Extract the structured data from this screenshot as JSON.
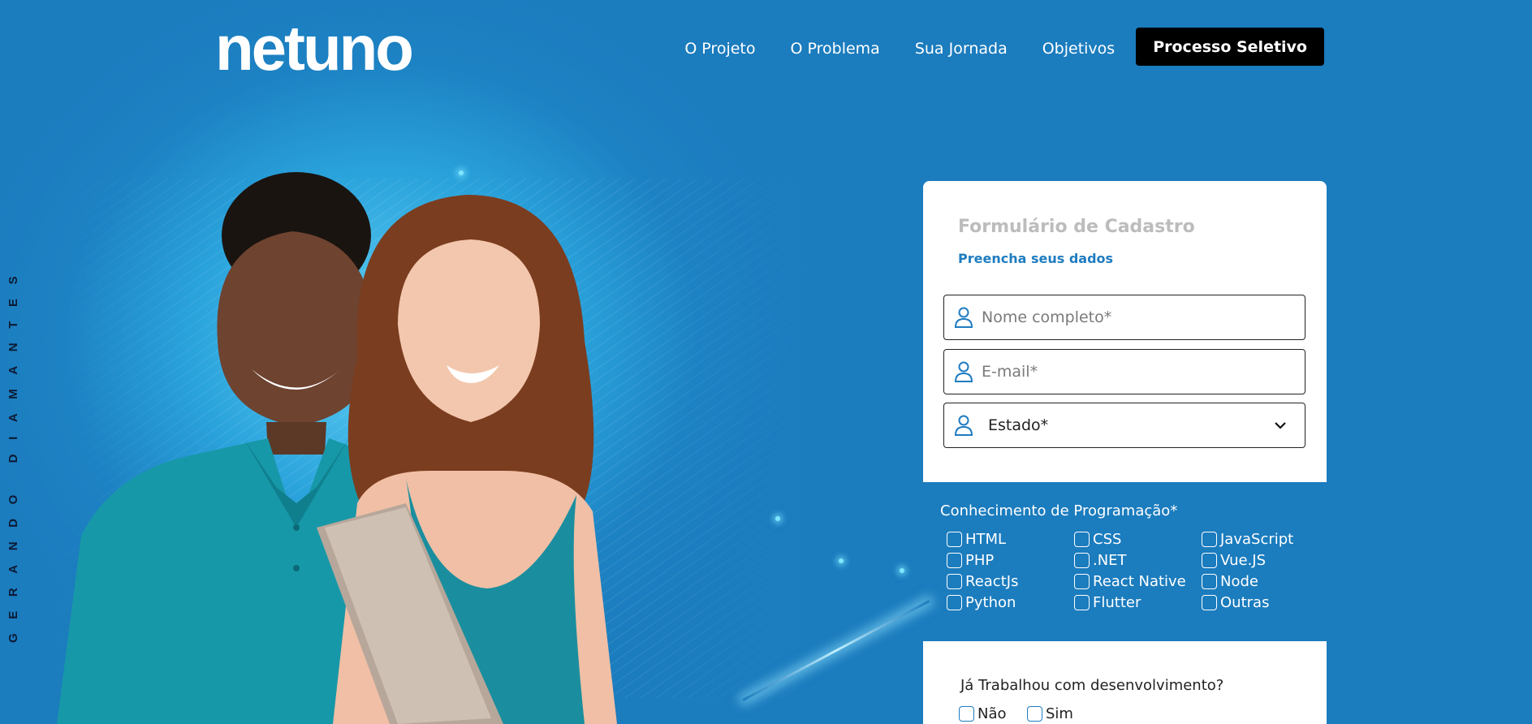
{
  "header": {
    "logo_text": "netuno",
    "nav": [
      "O Projeto",
      "O Problema",
      "Sua Jornada",
      "Objetivos"
    ],
    "cta_label": "Processo Seletivo"
  },
  "side_text": "GERANDO DIAMANTES",
  "form": {
    "title": "Formulário de Cadastro",
    "subtitle": "Preencha seus dados",
    "name_placeholder": "Nome completo*",
    "email_placeholder": "E-mail*",
    "state_value": "Estado*",
    "programming_title": "Conhecimento de Programação*",
    "skills": [
      [
        "HTML",
        "CSS",
        "JavaScript"
      ],
      [
        "PHP",
        ".NET",
        "Vue.JS"
      ],
      [
        "ReactJs",
        "React Native",
        "Node"
      ],
      [
        "Python",
        "Flutter",
        "Outras"
      ]
    ],
    "worked_question": "Já Trabalhou com desenvolvimento?",
    "no_label": "Não",
    "yes_label": "Sim"
  },
  "colors": {
    "background": "#1d82c3",
    "accent": "#1f7cc0",
    "cta_bg": "#000000",
    "form_bg": "#ffffff"
  },
  "icons": [
    "user-icon",
    "chevron-down-icon"
  ]
}
